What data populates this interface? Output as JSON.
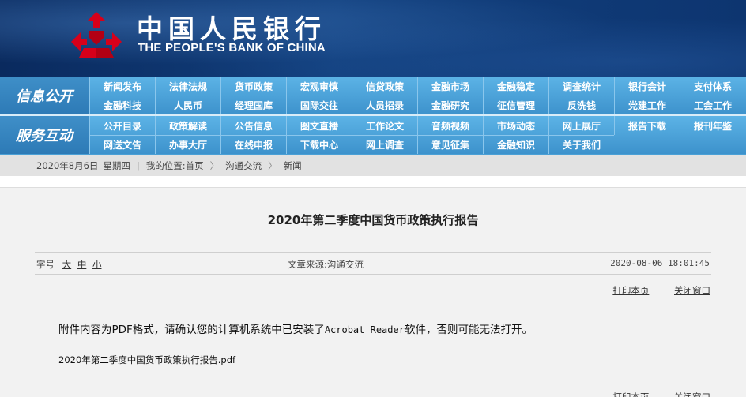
{
  "header": {
    "name_cn": "中国人民银行",
    "name_en": "THE PEOPLE'S BANK OF CHINA",
    "logo_color": "#d7001a"
  },
  "nav": {
    "section1": {
      "title": "信息公开",
      "row1": [
        "新闻发布",
        "法律法规",
        "货币政策",
        "宏观审慎",
        "信贷政策",
        "金融市场",
        "金融稳定",
        "调查统计",
        "银行会计",
        "支付体系"
      ],
      "row2": [
        "金融科技",
        "人民币",
        "经理国库",
        "国际交往",
        "人员招录",
        "金融研究",
        "征信管理",
        "反洗钱",
        "党建工作",
        "工会工作"
      ]
    },
    "section2": {
      "title": "服务互动",
      "row1": [
        "公开目录",
        "政策解读",
        "公告信息",
        "图文直播",
        "工作论文",
        "音频视频",
        "市场动态",
        "网上展厅",
        "报告下载",
        "报刊年鉴"
      ],
      "row2": [
        "网送文告",
        "办事大厅",
        "在线申报",
        "下载中心",
        "网上调查",
        "意见征集",
        "金融知识",
        "关于我们"
      ]
    }
  },
  "breadcrumb": {
    "date": "2020年8月6日",
    "weekday": "星期四",
    "location_label": "我的位置:",
    "home": "首页",
    "level1": "沟通交流",
    "level2": "新闻"
  },
  "article": {
    "title": "2020年第二季度中国货币政策执行报告",
    "font_size_label": "字号",
    "font_large": "大",
    "font_medium": "中",
    "font_small": "小",
    "source": "文章来源:沟通交流",
    "datetime": "2020-08-06  18:01:45",
    "print_label": "打印本页",
    "close_label": "关闭窗口",
    "notice_prefix": "附件内容为PDF格式，请确认您的计算机系统中已安装了",
    "notice_software": "Acrobat Reader",
    "notice_suffix": "软件，否则可能无法打开。",
    "attachment": "2020年第二季度中国货币政策执行报告.pdf"
  }
}
